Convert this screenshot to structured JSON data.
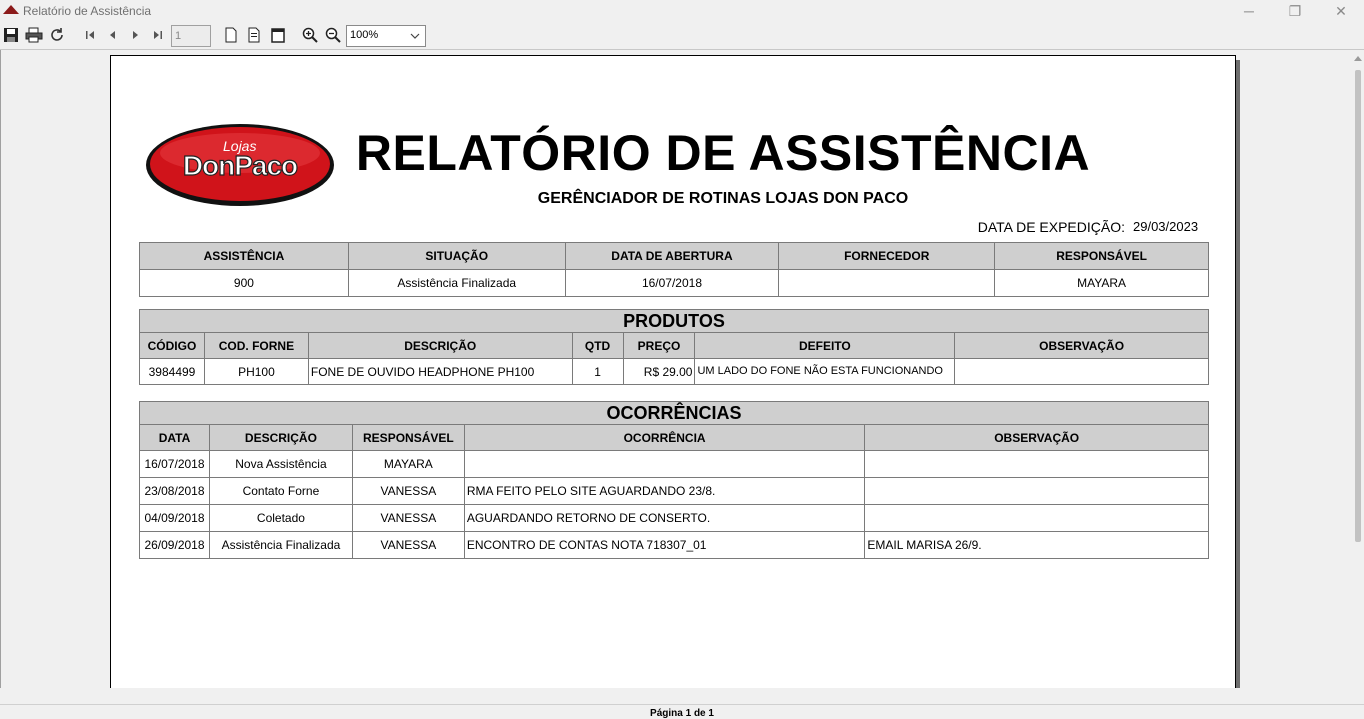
{
  "window": {
    "title": "Relatório de Assistência",
    "minimize": "─",
    "maximize": "❐",
    "close": "✕"
  },
  "toolbar": {
    "page_value": "1",
    "zoom_value": "100%"
  },
  "status": {
    "page_info": "Página 1 de 1"
  },
  "report": {
    "logo_small": "Lojas",
    "logo_big": "DonPaco",
    "title": "RELATÓRIO DE ASSISTÊNCIA",
    "subtitle": "GERÊNCIADOR DE ROTINAS LOJAS DON PACO",
    "expedicao_label": "DATA DE EXPEDIÇÃO:",
    "expedicao_value": "29/03/2023",
    "info": {
      "headers": [
        "ASSISTÊNCIA",
        "SITUAÇÃO",
        "DATA DE ABERTURA",
        "FORNECEDOR",
        "RESPONSÁVEL"
      ],
      "values": [
        "900",
        "Assistência Finalizada",
        "16/07/2018",
        "",
        "MAYARA"
      ]
    },
    "produtos": {
      "title": "PRODUTOS",
      "headers": [
        "CÓDIGO",
        "COD. FORNE",
        "DESCRIÇÃO",
        "QTD",
        "PREÇO",
        "DEFEITO",
        "OBSERVAÇÃO"
      ],
      "rows": [
        [
          "3984499",
          "PH100",
          "FONE DE OUVIDO HEADPHONE PH100",
          "1",
          "R$ 29.00",
          "UM LADO DO FONE NÃO ESTA FUNCIONANDO",
          ""
        ]
      ]
    },
    "ocorrencias": {
      "title": "OCORRÊNCIAS",
      "headers": [
        "DATA",
        "DESCRIÇÃO",
        "RESPONSÁVEL",
        "OCORRÊNCIA",
        "OBSERVAÇÃO"
      ],
      "rows": [
        [
          "16/07/2018",
          "Nova Assistência",
          "MAYARA",
          "",
          ""
        ],
        [
          "23/08/2018",
          "Contato Forne",
          "VANESSA",
          "RMA FEITO PELO SITE AGUARDANDO 23/8.",
          ""
        ],
        [
          "04/09/2018",
          "Coletado",
          "VANESSA",
          "AGUARDANDO RETORNO DE CONSERTO.",
          ""
        ],
        [
          "26/09/2018",
          "Assistência Finalizada",
          "VANESSA",
          "ENCONTRO DE CONTAS NOTA 718307_01",
          "EMAIL MARISA 26/9."
        ]
      ]
    }
  }
}
